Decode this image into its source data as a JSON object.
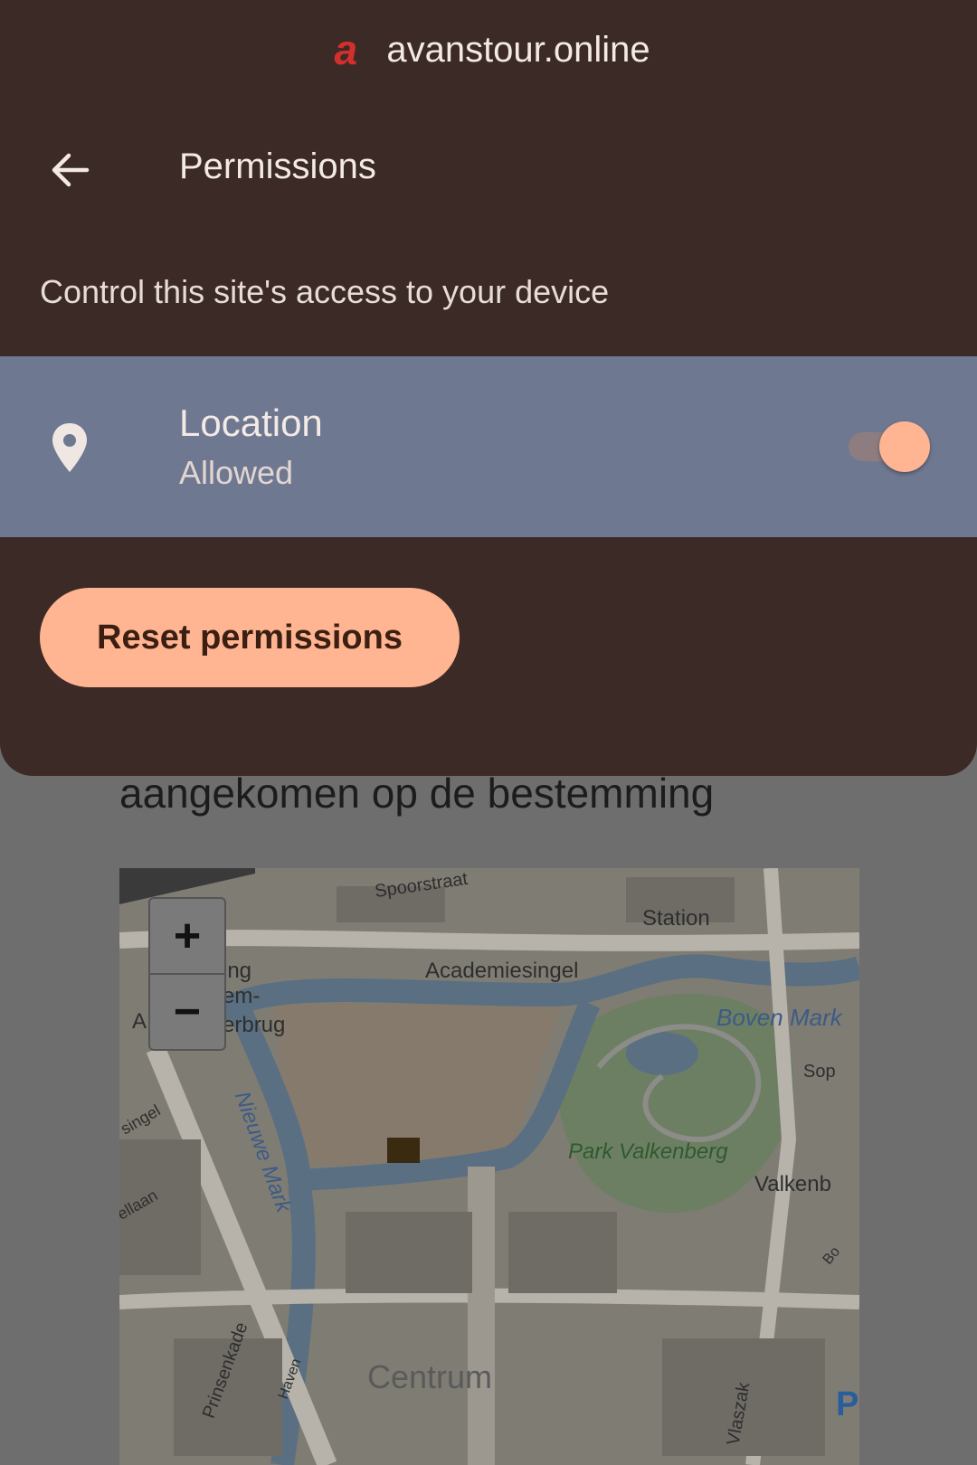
{
  "site": {
    "logo_letter": "a",
    "domain": "avanstour.online"
  },
  "header": {
    "back_icon": "arrow-left-icon",
    "title": "Permissions"
  },
  "subtitle": "Control this site's access to your device",
  "permissions": [
    {
      "icon": "location-pin-icon",
      "name": "Location",
      "state": "Allowed",
      "enabled": true
    }
  ],
  "reset_button": "Reset permissions",
  "background_page": {
    "heading": "aangekomen op de bestemming",
    "map": {
      "zoom_in": "+",
      "zoom_out": "−",
      "labels": {
        "spoorstraat": "Spoorstraat",
        "station": "Station",
        "academiesingel": "Academiesingel",
        "ing": "ing",
        "em": "em-",
        "a": "A",
        "erbrug": "erbrug",
        "boven_mark": "Boven Mark",
        "sop": "Sop",
        "singel": "singel",
        "nieuwe_mark": "Nieuwe Mark",
        "park_valkenberg": "Park Valkenberg",
        "valkenb": "Valkenb",
        "ellaan": "ellaan",
        "prinsenkade": "Prinsenkade",
        "haven": "Haven",
        "centrum": "Centrum",
        "vlaszak": "Vlaszak",
        "bo": "Bo",
        "parking": "P"
      }
    }
  },
  "colors": {
    "sheet_bg": "#3b2a25",
    "row_highlight": "#6f7891",
    "accent": "#ffb492",
    "logo_red": "#d32f2f"
  }
}
